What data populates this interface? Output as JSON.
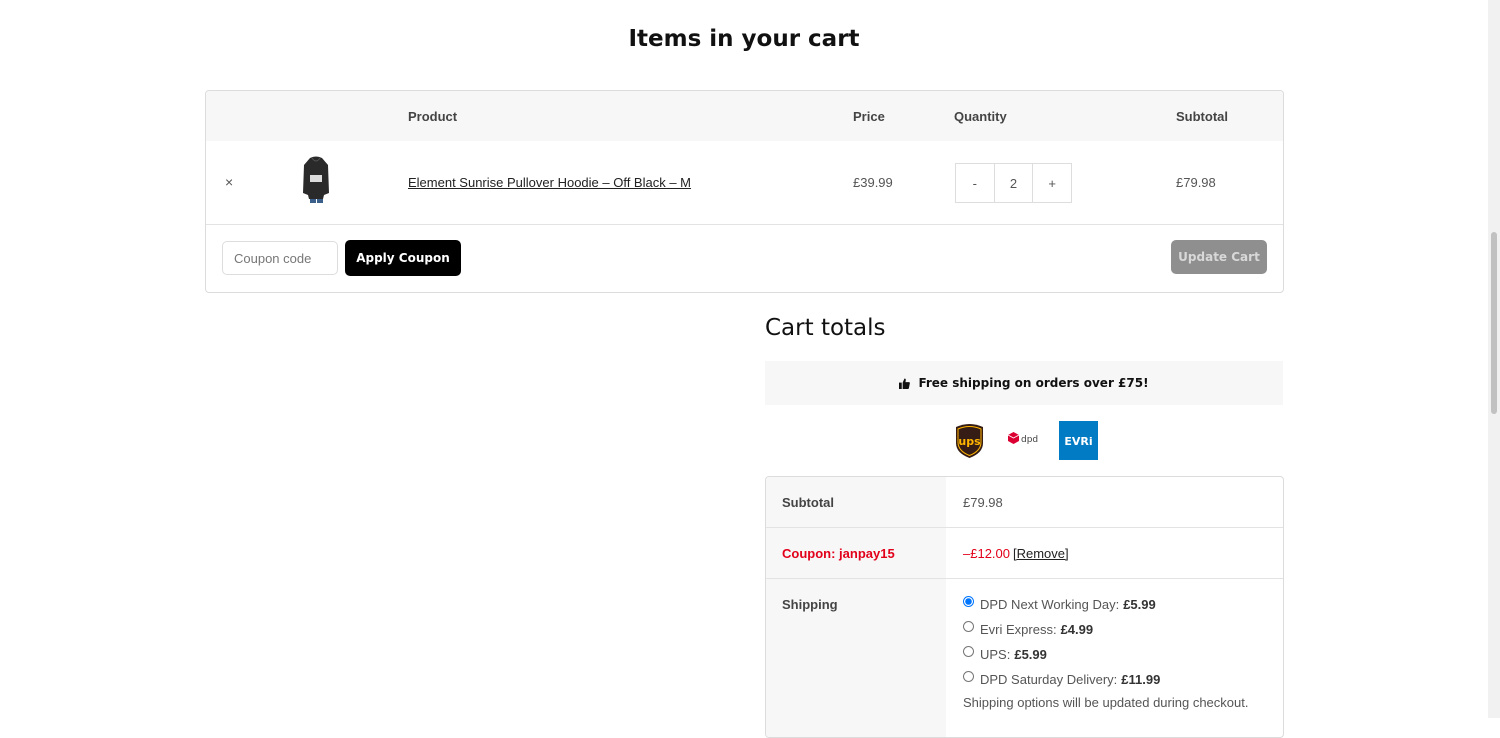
{
  "page": {
    "title": "Items in your cart"
  },
  "cart": {
    "headers": {
      "product": "Product",
      "price": "Price",
      "quantity": "Quantity",
      "subtotal": "Subtotal"
    },
    "items": [
      {
        "remove_symbol": "×",
        "name": "Element Sunrise Pullover Hoodie – Off Black – M",
        "price": "£39.99",
        "qty_minus": "-",
        "qty": "2",
        "qty_plus": "+",
        "subtotal": "£79.98",
        "thumbnail": "hoodie-image"
      }
    ],
    "coupon_placeholder": "Coupon code",
    "apply_coupon_label": "Apply Coupon",
    "update_cart_label": "Update Cart"
  },
  "totals": {
    "title": "Cart totals",
    "free_shipping_icon": "thumbs-up-icon",
    "free_shipping_text": "Free shipping on orders over £75!",
    "carriers": [
      "ups",
      "dpd",
      "EVRi"
    ],
    "subtotal_label": "Subtotal",
    "subtotal_value": "£79.98",
    "coupon_label": "Coupon: janpay15",
    "coupon_discount": "–£12.00",
    "coupon_remove": "[Remove]",
    "shipping_label": "Shipping",
    "shipping_options": [
      {
        "name": "DPD Next Working Day:",
        "price": "£5.99",
        "selected": true
      },
      {
        "name": "Evri Express:",
        "price": "£4.99",
        "selected": false
      },
      {
        "name": "UPS:",
        "price": "£5.99",
        "selected": false
      },
      {
        "name": "DPD Saturday Delivery:",
        "price": "£11.99",
        "selected": false
      }
    ],
    "shipping_note": "Shipping options will be updated during checkout."
  },
  "colors": {
    "accent_red": "#e2001a",
    "button_black": "#000000",
    "button_disabled": "#8f8f8f"
  }
}
